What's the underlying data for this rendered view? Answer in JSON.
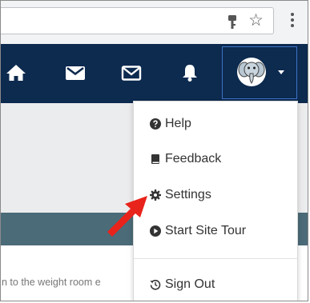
{
  "browser": {
    "key_icon": "key-icon",
    "star_icon": "star-icon",
    "menu_icon": "vertical-dots-icon"
  },
  "navbar": {
    "icons": [
      "home-icon",
      "envelope-icon",
      "envelope-outline-icon",
      "bell-icon"
    ],
    "avatar_icon": "user-avatar-elephant",
    "dropdown_caret": "caret-down-icon",
    "background": "#0d2a4f"
  },
  "dropdown": {
    "items": [
      {
        "label": "Help",
        "icon": "question-circle-icon"
      },
      {
        "label": "Feedback",
        "icon": "book-icon"
      },
      {
        "label": "Settings",
        "icon": "gear-icon"
      },
      {
        "label": "Start Site Tour",
        "icon": "play-circle-icon"
      },
      {
        "label": "Sign Out",
        "icon": "history-icon"
      }
    ]
  },
  "page": {
    "body_text": "n to the weight room e"
  },
  "annotation": {
    "arrow_color": "#e8231b",
    "points_to": "Settings"
  }
}
